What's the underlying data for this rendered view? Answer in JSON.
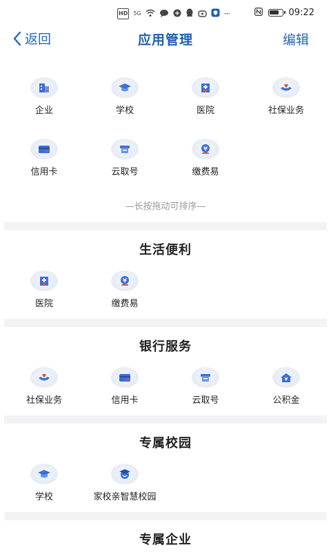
{
  "status": {
    "net_badge": "HD",
    "signal_label": "5G",
    "more_dots": "···",
    "time": "09:22"
  },
  "header": {
    "back_label": "返回",
    "title": "应用管理",
    "edit_label": "编辑"
  },
  "my_apps": {
    "items": [
      {
        "label": "企业",
        "icon": "enterprise-icon"
      },
      {
        "label": "学校",
        "icon": "school-icon"
      },
      {
        "label": "医院",
        "icon": "hospital-icon"
      },
      {
        "label": "社保业务",
        "icon": "social-security-icon"
      },
      {
        "label": "信用卡",
        "icon": "credit-card-icon"
      },
      {
        "label": "云取号",
        "icon": "queue-ticket-icon"
      },
      {
        "label": "缴费易",
        "icon": "payment-icon"
      }
    ],
    "hint": "—长按拖动可排序—"
  },
  "sections": [
    {
      "title": "生活便利",
      "items": [
        {
          "label": "医院",
          "icon": "hospital-icon"
        },
        {
          "label": "缴费易",
          "icon": "payment-icon"
        }
      ]
    },
    {
      "title": "银行服务",
      "items": [
        {
          "label": "社保业务",
          "icon": "social-security-icon"
        },
        {
          "label": "信用卡",
          "icon": "credit-card-icon"
        },
        {
          "label": "云取号",
          "icon": "queue-ticket-icon"
        },
        {
          "label": "公积金",
          "icon": "housing-fund-icon"
        }
      ]
    },
    {
      "title": "专属校园",
      "items": [
        {
          "label": "学校",
          "icon": "school-icon"
        },
        {
          "label": "家校亲智慧校园",
          "icon": "smart-campus-icon"
        }
      ]
    },
    {
      "title": "专属企业",
      "items": []
    }
  ],
  "colors": {
    "accent": "#1e5fb0",
    "icon_blue": "#3b6fd8",
    "icon_red": "#e3503c",
    "divider": "#f2f3f5"
  }
}
